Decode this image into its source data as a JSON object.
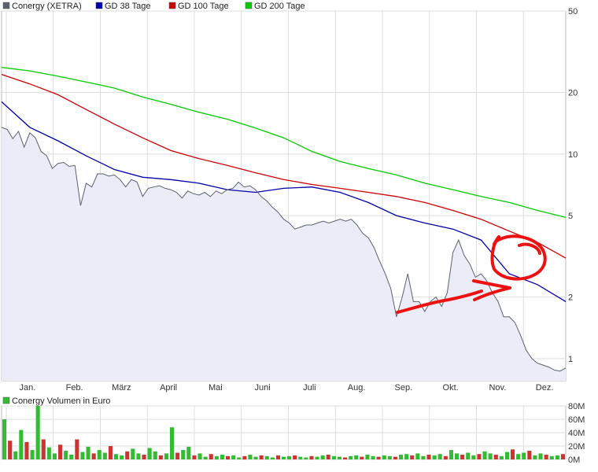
{
  "chart_data": [
    {
      "type": "line",
      "scale": "log",
      "ylim": [
        0.78,
        50
      ],
      "y_ticks": [
        1,
        2,
        5,
        10,
        20,
        50
      ],
      "y_tick_labels": [
        "1",
        "2",
        "5",
        "10",
        "20",
        "50"
      ],
      "x_months": [
        "Jan.",
        "Feb.",
        "März",
        "April",
        "Mai",
        "Juni",
        "Juli",
        "Aug.",
        "Sep.",
        "Okt.",
        "Nov.",
        "Dez."
      ],
      "grid": true,
      "legend": "top-left",
      "series": [
        {
          "name": "Conergy (XETRA)",
          "color": "#5a6070",
          "fill": "#ececf8",
          "x": [
            0,
            0.01,
            0.02,
            0.03,
            0.04,
            0.05,
            0.06,
            0.07,
            0.08,
            0.09,
            0.1,
            0.11,
            0.12,
            0.13,
            0.14,
            0.15,
            0.16,
            0.17,
            0.18,
            0.19,
            0.2,
            0.21,
            0.22,
            0.23,
            0.24,
            0.25,
            0.26,
            0.27,
            0.28,
            0.29,
            0.3,
            0.31,
            0.32,
            0.33,
            0.34,
            0.35,
            0.36,
            0.37,
            0.38,
            0.39,
            0.4,
            0.41,
            0.42,
            0.43,
            0.44,
            0.45,
            0.46,
            0.47,
            0.48,
            0.49,
            0.5,
            0.51,
            0.52,
            0.53,
            0.54,
            0.55,
            0.56,
            0.57,
            0.58,
            0.59,
            0.6,
            0.61,
            0.62,
            0.63,
            0.64,
            0.65,
            0.66,
            0.67,
            0.68,
            0.69,
            0.7,
            0.71,
            0.72,
            0.73,
            0.74,
            0.75,
            0.76,
            0.77,
            0.78,
            0.79,
            0.8,
            0.81,
            0.82,
            0.83,
            0.84,
            0.85,
            0.86,
            0.87,
            0.88,
            0.89,
            0.9,
            0.91,
            0.92,
            0.93,
            0.94,
            0.95,
            0.96,
            0.97,
            0.98,
            0.99,
            1.0
          ],
          "values": [
            13.5,
            13.2,
            11.9,
            12.9,
            10.8,
            12.7,
            12.0,
            10.3,
            9.8,
            8.5,
            9.0,
            9.1,
            8.7,
            8.8,
            5.6,
            7.2,
            6.9,
            8.0,
            8.0,
            7.8,
            7.9,
            7.5,
            6.9,
            7.5,
            7.3,
            6.2,
            6.8,
            6.9,
            7.0,
            6.8,
            6.7,
            6.5,
            6.1,
            6.6,
            6.4,
            6.3,
            6.5,
            6.2,
            6.6,
            6.4,
            6.7,
            6.8,
            7.3,
            6.9,
            7.0,
            6.7,
            6.2,
            5.9,
            5.5,
            5.2,
            4.8,
            4.6,
            4.3,
            4.4,
            4.5,
            4.5,
            4.6,
            4.7,
            4.6,
            4.7,
            4.8,
            4.7,
            4.8,
            4.5,
            4.1,
            3.9,
            3.5,
            3.0,
            2.6,
            2.2,
            1.6,
            2.0,
            2.6,
            1.9,
            1.9,
            1.7,
            1.9,
            2.0,
            1.8,
            2.1,
            3.3,
            3.8,
            3.2,
            2.9,
            2.5,
            2.6,
            2.4,
            2.1,
            1.9,
            1.6,
            1.6,
            1.5,
            1.3,
            1.1,
            1.0,
            0.95,
            0.93,
            0.91,
            0.88,
            0.87,
            0.9
          ]
        },
        {
          "name": "GD 38 Tage",
          "color": "#0000aa",
          "x": [
            0,
            0.05,
            0.1,
            0.15,
            0.2,
            0.25,
            0.3,
            0.35,
            0.4,
            0.45,
            0.5,
            0.55,
            0.6,
            0.65,
            0.7,
            0.75,
            0.8,
            0.85,
            0.9,
            0.95,
            1.0
          ],
          "values": [
            18,
            13.5,
            11.6,
            9.8,
            8.4,
            7.7,
            7.5,
            7.2,
            6.7,
            6.5,
            6.8,
            6.9,
            6.5,
            5.8,
            5.0,
            4.6,
            4.3,
            3.8,
            2.6,
            2.3,
            1.9
          ]
        },
        {
          "name": "GD 100 Tage",
          "color": "#cc0000",
          "x": [
            0,
            0.05,
            0.1,
            0.15,
            0.2,
            0.25,
            0.3,
            0.35,
            0.4,
            0.45,
            0.5,
            0.55,
            0.6,
            0.65,
            0.7,
            0.75,
            0.8,
            0.85,
            0.9,
            0.95,
            1.0
          ],
          "values": [
            24.5,
            22.0,
            19.5,
            16.5,
            14.0,
            12.0,
            10.4,
            9.5,
            8.8,
            8.1,
            7.5,
            7.1,
            6.8,
            6.5,
            6.2,
            5.8,
            5.3,
            4.8,
            4.2,
            3.7,
            3.1
          ]
        },
        {
          "name": "GD 200 Tage",
          "color": "#00cc00",
          "x": [
            0,
            0.05,
            0.1,
            0.15,
            0.2,
            0.25,
            0.3,
            0.35,
            0.4,
            0.45,
            0.5,
            0.55,
            0.6,
            0.65,
            0.7,
            0.75,
            0.8,
            0.85,
            0.9,
            0.95,
            1.0
          ],
          "values": [
            26.5,
            25.5,
            24.0,
            22.5,
            21.0,
            19.0,
            17.5,
            16.0,
            14.8,
            13.4,
            12.0,
            10.3,
            9.2,
            8.5,
            7.9,
            7.2,
            6.7,
            6.2,
            5.8,
            5.3,
            4.9
          ]
        }
      ]
    },
    {
      "type": "bar",
      "ylim": [
        0,
        80
      ],
      "y_ticks": [
        0,
        20,
        40,
        60,
        80
      ],
      "y_tick_labels": [
        "0M",
        "20M",
        "40M",
        "60M",
        "80M"
      ],
      "grid": true,
      "legend": "top-left",
      "series": [
        {
          "name": "Conergy Volumen in Euro",
          "color_up": "#33bb33",
          "color_down": "#cc3333",
          "values": [
            60,
            28,
            12,
            44,
            26,
            14,
            80,
            30,
            18,
            9,
            22,
            13,
            7,
            30,
            11,
            19,
            9,
            14,
            10,
            20,
            8,
            6,
            12,
            16,
            9,
            7,
            17,
            12,
            6,
            9,
            48,
            10,
            14,
            19,
            6,
            9,
            4,
            8,
            5,
            7,
            5,
            6,
            3,
            5,
            7,
            4,
            6,
            5,
            3,
            6,
            4,
            5,
            6,
            4,
            3,
            5,
            4,
            6,
            7,
            5,
            4,
            3,
            5,
            6,
            4,
            7,
            5,
            4,
            6,
            5,
            4,
            7,
            8,
            6,
            9,
            5,
            7,
            6,
            8,
            5,
            14,
            9,
            7,
            10,
            6,
            8,
            12,
            9,
            7,
            5,
            11,
            15,
            8,
            10,
            13,
            6,
            9,
            7,
            5,
            6,
            8
          ]
        }
      ]
    }
  ]
}
